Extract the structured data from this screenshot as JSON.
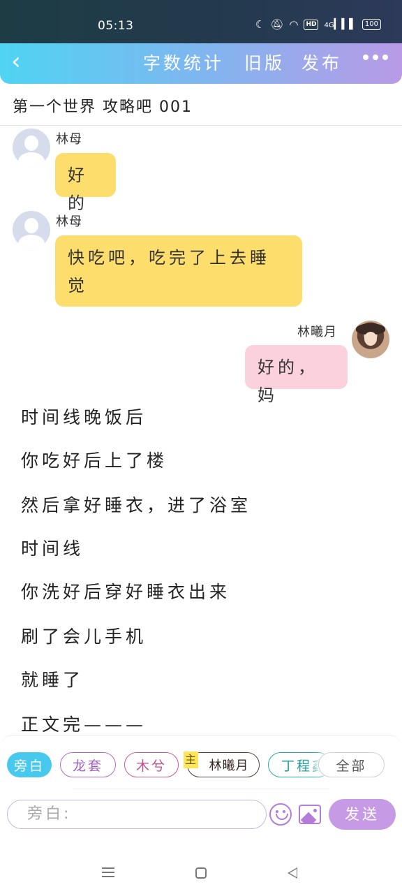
{
  "status_bar": {
    "time": "05:13",
    "icons": [
      "moon-icon",
      "mute-icon",
      "wifi-icon",
      "hd-icon",
      "signal-4g-icon",
      "battery-icon"
    ],
    "network": "4G",
    "hd": "HD",
    "battery": "100"
  },
  "top_bar": {
    "back_icon": "‹",
    "actions": [
      "字数统计",
      "旧版",
      "发布"
    ],
    "more_icon": "more-icon"
  },
  "document": {
    "title": "第一个世界  攻略吧 001"
  },
  "messages": [
    {
      "speaker": "林母",
      "text": "好的",
      "side": "left",
      "color": "#fddd6c"
    },
    {
      "speaker": "林母",
      "text": "快吃吧，吃完了上去睡觉",
      "side": "left",
      "color": "#fddd6c"
    },
    {
      "speaker": "林曦月",
      "text": "好的，妈",
      "side": "right",
      "color": "#fad1dc"
    }
  ],
  "narration": [
    "时间线晚饭后",
    "你吃好后上了楼",
    "然后拿好睡衣，进了浴室",
    "时间线",
    "你洗好后穿好睡衣出来",
    "刷了会儿手机",
    "就睡了",
    "正文完———"
  ],
  "role_chips": [
    {
      "label": "旁白",
      "selected": true,
      "color": "#47c9ee"
    },
    {
      "label": "龙套",
      "color": "#b06ad0"
    },
    {
      "label": "木兮",
      "color": "#d05a96"
    },
    {
      "label": "林曦月",
      "badge": "主",
      "color": "#5a4038"
    },
    {
      "label": "丁程鑫",
      "color": "#24b0a8"
    },
    {
      "label": "全部",
      "color": "#cfcfcf"
    }
  ],
  "composer": {
    "placeholder": "旁白:",
    "send_label": "发送"
  },
  "nav_bar": {
    "icons": [
      "menu-icon",
      "home-icon",
      "back-icon"
    ]
  }
}
